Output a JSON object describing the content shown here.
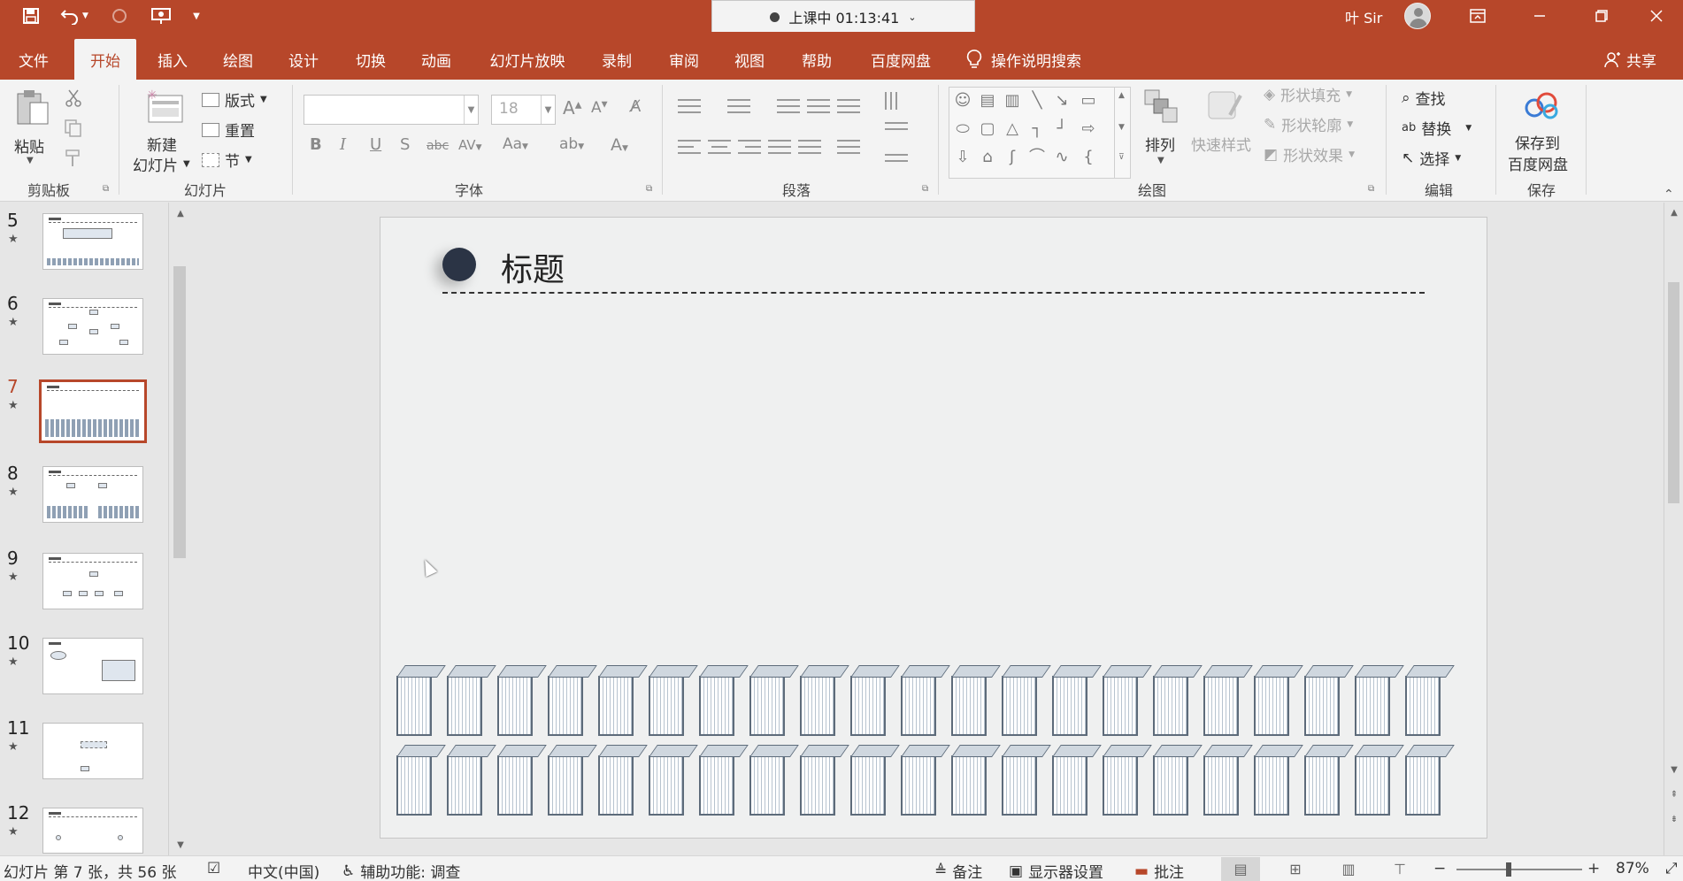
{
  "titlebar": {
    "recording_label": "上课中 01:13:41",
    "user_name": "叶 Sir",
    "icons": [
      "save-icon",
      "undo-icon",
      "redo-icon",
      "present-from-start-icon",
      "customize-qat-icon"
    ],
    "window_controls": [
      "ribbon-display-icon",
      "minimize-icon",
      "restore-icon",
      "close-icon"
    ]
  },
  "tabs": [
    {
      "label": "文件"
    },
    {
      "label": "开始"
    },
    {
      "label": "插入"
    },
    {
      "label": "绘图"
    },
    {
      "label": "设计"
    },
    {
      "label": "切换"
    },
    {
      "label": "动画"
    },
    {
      "label": "幻灯片放映"
    },
    {
      "label": "录制"
    },
    {
      "label": "审阅"
    },
    {
      "label": "视图"
    },
    {
      "label": "帮助"
    },
    {
      "label": "百度网盘"
    }
  ],
  "search_tab": {
    "label": "操作说明搜索"
  },
  "share": {
    "label": "共享"
  },
  "ribbon": {
    "clipboard": {
      "paste": "粘贴",
      "group": "剪贴板"
    },
    "slides": {
      "new_slide_line1": "新建",
      "new_slide_line2": "幻灯片",
      "layout": "版式",
      "reset": "重置",
      "section": "节",
      "group": "幻灯片"
    },
    "font": {
      "size": "18",
      "group": "字体"
    },
    "paragraph": {
      "group": "段落"
    },
    "drawing": {
      "arrange": "排列",
      "quick_styles": "快速样式",
      "shape_fill": "形状填充",
      "shape_outline": "形状轮廓",
      "shape_effects": "形状效果",
      "group": "绘图"
    },
    "editing": {
      "find": "查找",
      "replace": "替换",
      "select": "选择",
      "group": "编辑"
    },
    "save": {
      "line1": "保存到",
      "line2": "百度网盘",
      "group": "保存"
    }
  },
  "thumbnails": [
    {
      "number": "5",
      "star": "★",
      "kind": "grid"
    },
    {
      "number": "6",
      "star": "★",
      "kind": "tree"
    },
    {
      "number": "7",
      "star": "★",
      "kind": "grid",
      "active": true
    },
    {
      "number": "8",
      "star": "★",
      "kind": "grid"
    },
    {
      "number": "9",
      "star": "★",
      "kind": "tree"
    },
    {
      "number": "10",
      "star": "★",
      "kind": "tree"
    },
    {
      "number": "11",
      "star": "★",
      "kind": "tree"
    },
    {
      "number": "12",
      "star": "★",
      "kind": "tree"
    }
  ],
  "slide": {
    "title": "标题"
  },
  "status": {
    "slide_info": "幻灯片 第 7 张，共 56 张",
    "language": "中文(中国)",
    "accessibility": "辅助功能: 调查",
    "notes": "备注",
    "display_settings": "显示器设置",
    "comments": "批注",
    "zoom_minus": "−",
    "zoom_plus": "+",
    "zoom_level": "87%"
  },
  "colors": {
    "accent": "#b7472a",
    "ribbon_bg": "#f3f3f3",
    "workspace_bg": "#e6e6e6"
  }
}
